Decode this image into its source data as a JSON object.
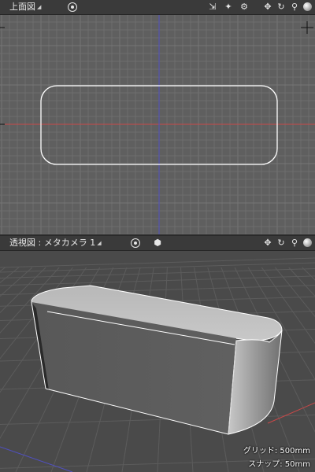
{
  "top_view": {
    "title": "上面図",
    "icons": [
      "target-icon",
      "axis-move-icon",
      "light-icon",
      "gear-icon",
      "pan-icon",
      "rotate-icon",
      "zoom-icon",
      "sphere-icon"
    ]
  },
  "perspective_view": {
    "title": "透視図 : メタカメラ 1",
    "icons": [
      "target-icon",
      "cube-icon",
      "pan-icon",
      "rotate-icon",
      "zoom-icon",
      "sphere-icon"
    ]
  },
  "status": {
    "grid": "グリッド: 500mm",
    "snap": "スナップ: 50mm"
  },
  "colors": {
    "top_bg": "#5f5f5f",
    "persp_bg": "#4a4a4a",
    "x_axis": "#c84848",
    "z_axis": "#5050c0",
    "shape_outline": "#ffffff"
  }
}
